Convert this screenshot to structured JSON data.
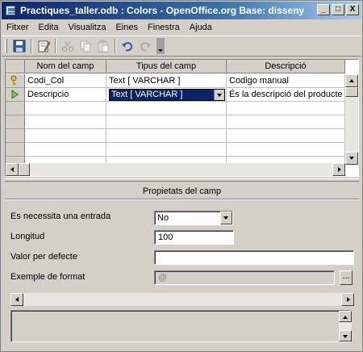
{
  "window": {
    "title": "Practiques_taller.odb : Colors - OpenOffice.org Base: disseny de ...",
    "minimize_label": "_",
    "maximize_label": "□",
    "close_label": "X"
  },
  "menu": [
    "Fitxer",
    "Edita",
    "Visualitza",
    "Eines",
    "Finestra",
    "Ajuda"
  ],
  "toolbar": {
    "icons": [
      "save-icon",
      "edit-icon",
      "cut-icon",
      "copy-icon",
      "paste-icon",
      "undo-icon",
      "redo-icon"
    ]
  },
  "table": {
    "columns": [
      "Nom del camp",
      "Tipus del camp",
      "Descripció"
    ],
    "rows": [
      {
        "marker": "primary-key",
        "name": "Codi_Col",
        "type": "Text [ VARCHAR ]",
        "description": "Codigo manual"
      },
      {
        "marker": "current-row",
        "name": "Descripcio",
        "type": "Text [ VARCHAR ]",
        "description": "És la descripció del producte"
      }
    ],
    "empty_rows": 5
  },
  "properties": {
    "title": "Propietats del camp",
    "required_label": "Es necessita una entrada",
    "required_value": "No",
    "length_label": "Longitud",
    "length_value": "100",
    "default_label": "Valor per defecte",
    "default_value": "",
    "format_label": "Exemple de format",
    "format_value": "@",
    "format_button": "..."
  },
  "colors": {
    "titlebar_start": "#0a246a",
    "titlebar_end": "#a6caf0",
    "face": "#d4d0c8",
    "selection": "#0a246a"
  }
}
